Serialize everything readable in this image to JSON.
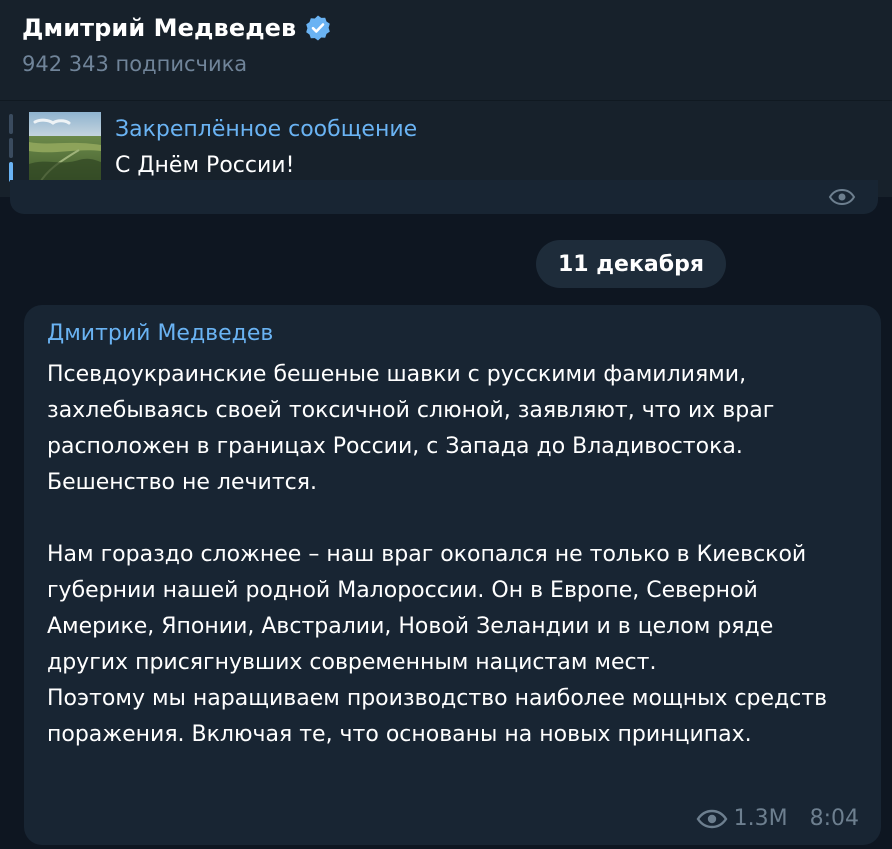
{
  "channel": {
    "title": "Дмитрий Медведев",
    "subscribers": "942 343 подписчика",
    "verified_icon": "verified-badge-icon"
  },
  "pinned": {
    "label": "Закреплённое сообщение",
    "text": "С Днём России!"
  },
  "date_separator": "11 декабря",
  "message": {
    "author": "Дмитрий Медведев",
    "text": "Псевдоукраинские бешеные шавки с русскими фамилиями, захлебываясь своей токсичной слюной, заявляют, что их враг расположен в границах России, с Запада до Владивостока. Бешенство не лечится.\n\nНам гораздо сложнее – наш враг окопался не только в Киевской губернии нашей родной Малороссии. Он в Европе, Северной Америке, Японии, Австралии, Новой Зеландии и в целом ряде других присягнувших современным нацистам мест.\nПоэтому мы наращиваем производство наиболее мощных средств поражения. Включая те, что основаны на новых принципах.",
    "views": "1.3M",
    "time": "8:04"
  },
  "colors": {
    "background": "#0e1621",
    "panel": "#17212b",
    "bubble": "#182533",
    "accent": "#6ab3f3",
    "muted": "#6d7f8f"
  }
}
